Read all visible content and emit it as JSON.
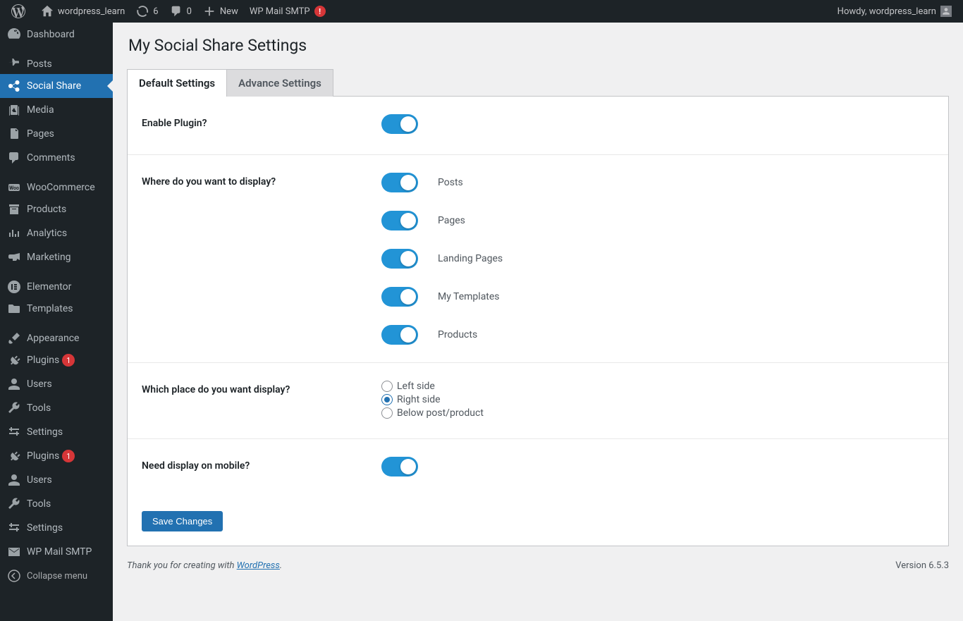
{
  "adminbar": {
    "site_name": "wordpress_learn",
    "updates_count": "6",
    "comments_count": "0",
    "new_label": "New",
    "smtp_label": "WP Mail SMTP",
    "smtp_err": "!",
    "howdy": "Howdy, wordpress_learn"
  },
  "sidebar": {
    "items": [
      {
        "label": "Dashboard",
        "icon": "dashboard"
      },
      {
        "label": "Posts",
        "icon": "pin",
        "sep": true
      },
      {
        "label": "Social Share",
        "icon": "share",
        "current": true
      },
      {
        "label": "Media",
        "icon": "media"
      },
      {
        "label": "Pages",
        "icon": "page"
      },
      {
        "label": "Comments",
        "icon": "comment"
      },
      {
        "label": "WooCommerce",
        "icon": "woo",
        "sep": true
      },
      {
        "label": "Products",
        "icon": "archive"
      },
      {
        "label": "Analytics",
        "icon": "analytics"
      },
      {
        "label": "Marketing",
        "icon": "megaphone"
      },
      {
        "label": "Elementor",
        "icon": "elementor",
        "sep": true
      },
      {
        "label": "Templates",
        "icon": "folder"
      },
      {
        "label": "Appearance",
        "icon": "brush",
        "sep": true
      },
      {
        "label": "Plugins",
        "icon": "plug",
        "badge": "1"
      },
      {
        "label": "Users",
        "icon": "user"
      },
      {
        "label": "Tools",
        "icon": "wrench"
      },
      {
        "label": "Settings",
        "icon": "sliders"
      },
      {
        "label": "Plugins",
        "icon": "plug",
        "badge": "1"
      },
      {
        "label": "Users",
        "icon": "user"
      },
      {
        "label": "Tools",
        "icon": "wrench"
      },
      {
        "label": "Settings",
        "icon": "sliders"
      },
      {
        "label": "WP Mail SMTP",
        "icon": "mail"
      }
    ],
    "collapse_label": "Collapse menu"
  },
  "page": {
    "title": "My Social Share Settings",
    "tabs": [
      "Default Settings",
      "Advance Settings"
    ],
    "active_tab": 0,
    "settings": {
      "enable_label": "Enable Plugin?",
      "display_where_label": "Where do you want to display?",
      "display_options": [
        {
          "label": "Posts",
          "on": true
        },
        {
          "label": "Pages",
          "on": true
        },
        {
          "label": "Landing Pages",
          "on": true
        },
        {
          "label": "My Templates",
          "on": true
        },
        {
          "label": "Products",
          "on": true
        }
      ],
      "place_label": "Which place do you want display?",
      "place_options": [
        {
          "label": "Left side",
          "checked": false
        },
        {
          "label": "Right side",
          "checked": true
        },
        {
          "label": "Below post/product",
          "checked": false
        }
      ],
      "mobile_label": "Need display on mobile?",
      "save_label": "Save Changes"
    }
  },
  "footer": {
    "thank_prefix": "Thank you for creating with ",
    "wp_link": "WordPress",
    "period": ".",
    "version": "Version 6.5.3"
  }
}
